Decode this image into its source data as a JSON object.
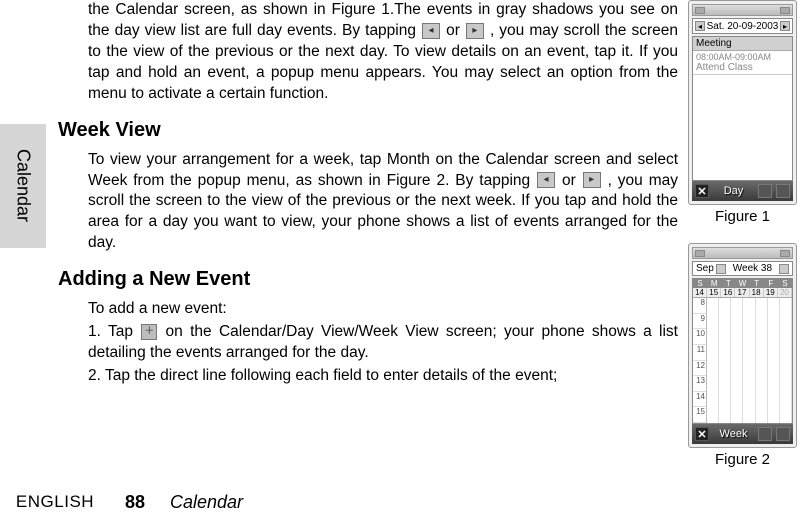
{
  "sidebarLabel": "Calendar",
  "intro": {
    "p1a": "the Calendar screen, as shown in Figure 1.The events in gray shadows you see on the day view list are full day events. By tapping ",
    "p1b": " or ",
    "p1c": " , you may scroll the screen to the view of the previous or the next day. To view details on an event, tap it. If you tap and hold an event, a popup menu appears. You may select an option from the menu to activate a certain function."
  },
  "weekView": {
    "heading": "Week View",
    "p1a": "To view your arrangement for a week, tap Month on the Calendar screen and select Week from the popup menu, as shown in Figure 2. By tapping ",
    "p1b": " or ",
    "p1c": " , you may scroll the screen to the view of the previous or the next week. If you tap and hold the area for a day you want to view, your phone shows a list of events arranged for the day."
  },
  "addEvent": {
    "heading": "Adding a New Event",
    "lead": "To add a new event:",
    "s1a": "1. Tap ",
    "s1b": " on the Calendar/Day View/Week View screen; your phone shows a list detailing the events arranged for the day.",
    "s2": "2. Tap the direct line following each field to enter details of the event;"
  },
  "footer": {
    "lang": "ENGLISH",
    "page": "88",
    "title": "Calendar"
  },
  "fig1": {
    "caption": "Figure 1",
    "date": "Sat. 20-09-2003",
    "allDay": "Meeting",
    "eventTime": "08:00AM-09:00AM",
    "eventTitle": "Attend Class",
    "bottomLabel": "Day"
  },
  "fig2": {
    "caption": "Figure 2",
    "month": "Sep",
    "week": "Week 38",
    "dow": [
      "S",
      "M",
      "T",
      "W",
      "T",
      "F",
      "S"
    ],
    "days": [
      "14",
      "15",
      "16",
      "17",
      "18",
      "19",
      "20"
    ],
    "hours": [
      "8",
      "9",
      "10",
      "11",
      "12",
      "13",
      "14",
      "15"
    ],
    "bottomLabel": "Week"
  },
  "icons": {
    "left": "◂",
    "right": "▸",
    "plus": "＋"
  }
}
